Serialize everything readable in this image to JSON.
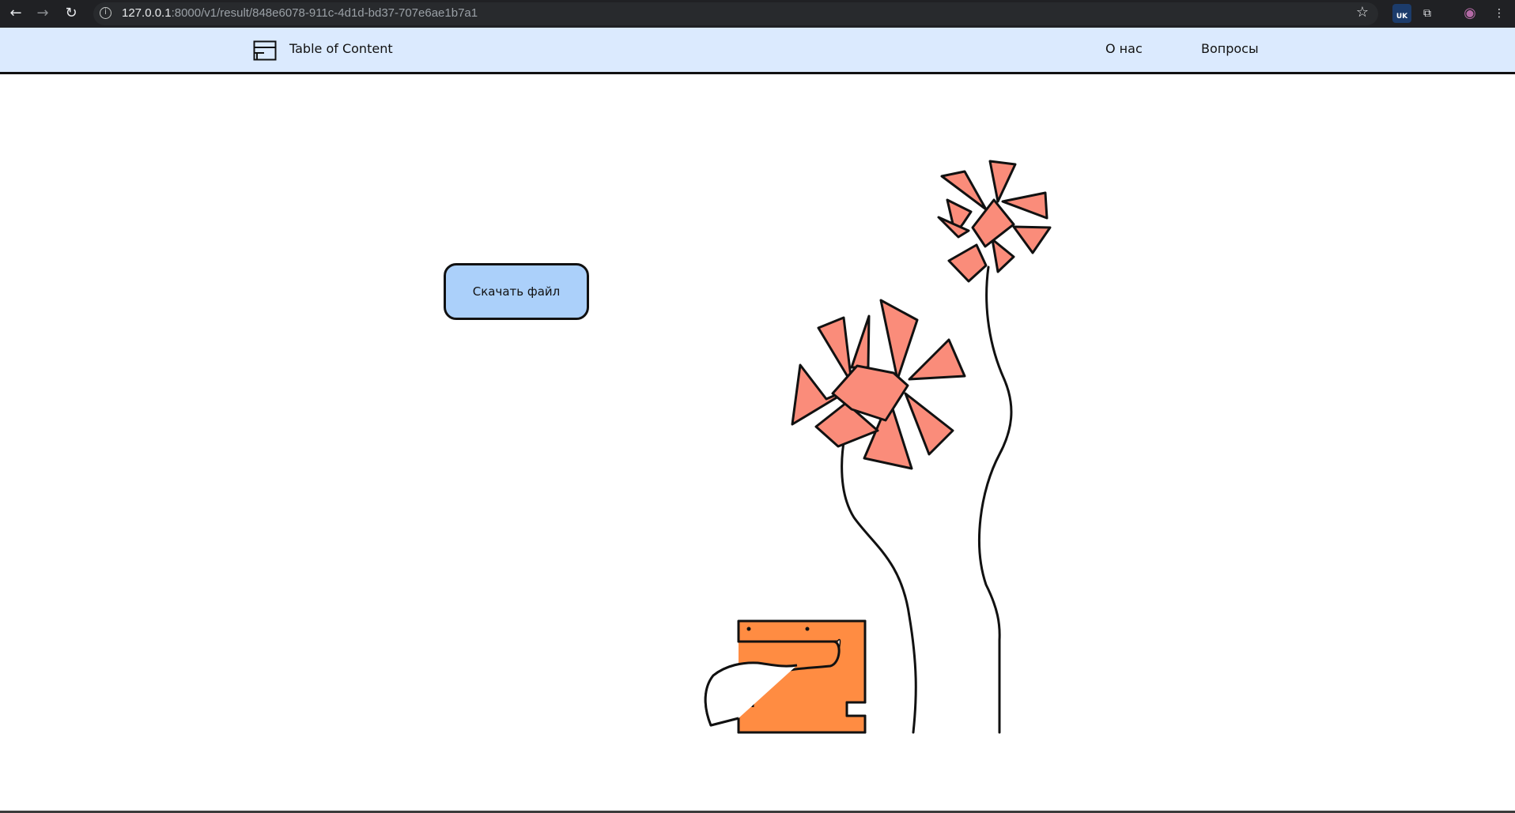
{
  "browser": {
    "url_host": "127.0.0.1",
    "url_rest": ":8000/v1/result/848e6078-911c-4d1d-bd37-707e6ae1b7a1",
    "back_icon": "arrow-left-icon",
    "forward_icon": "arrow-right-icon",
    "reload_icon": "reload-icon",
    "extension_uk_label": "UK"
  },
  "header": {
    "title": "Table of Content",
    "nav": [
      "О нас",
      "Вопросы"
    ]
  },
  "main": {
    "download_label": "Скачать файл"
  },
  "colors": {
    "header_bg": "#dbeafe",
    "button_bg": "#abd0fa",
    "petal": "#fa8c7a",
    "pot": "#ff8c42"
  }
}
